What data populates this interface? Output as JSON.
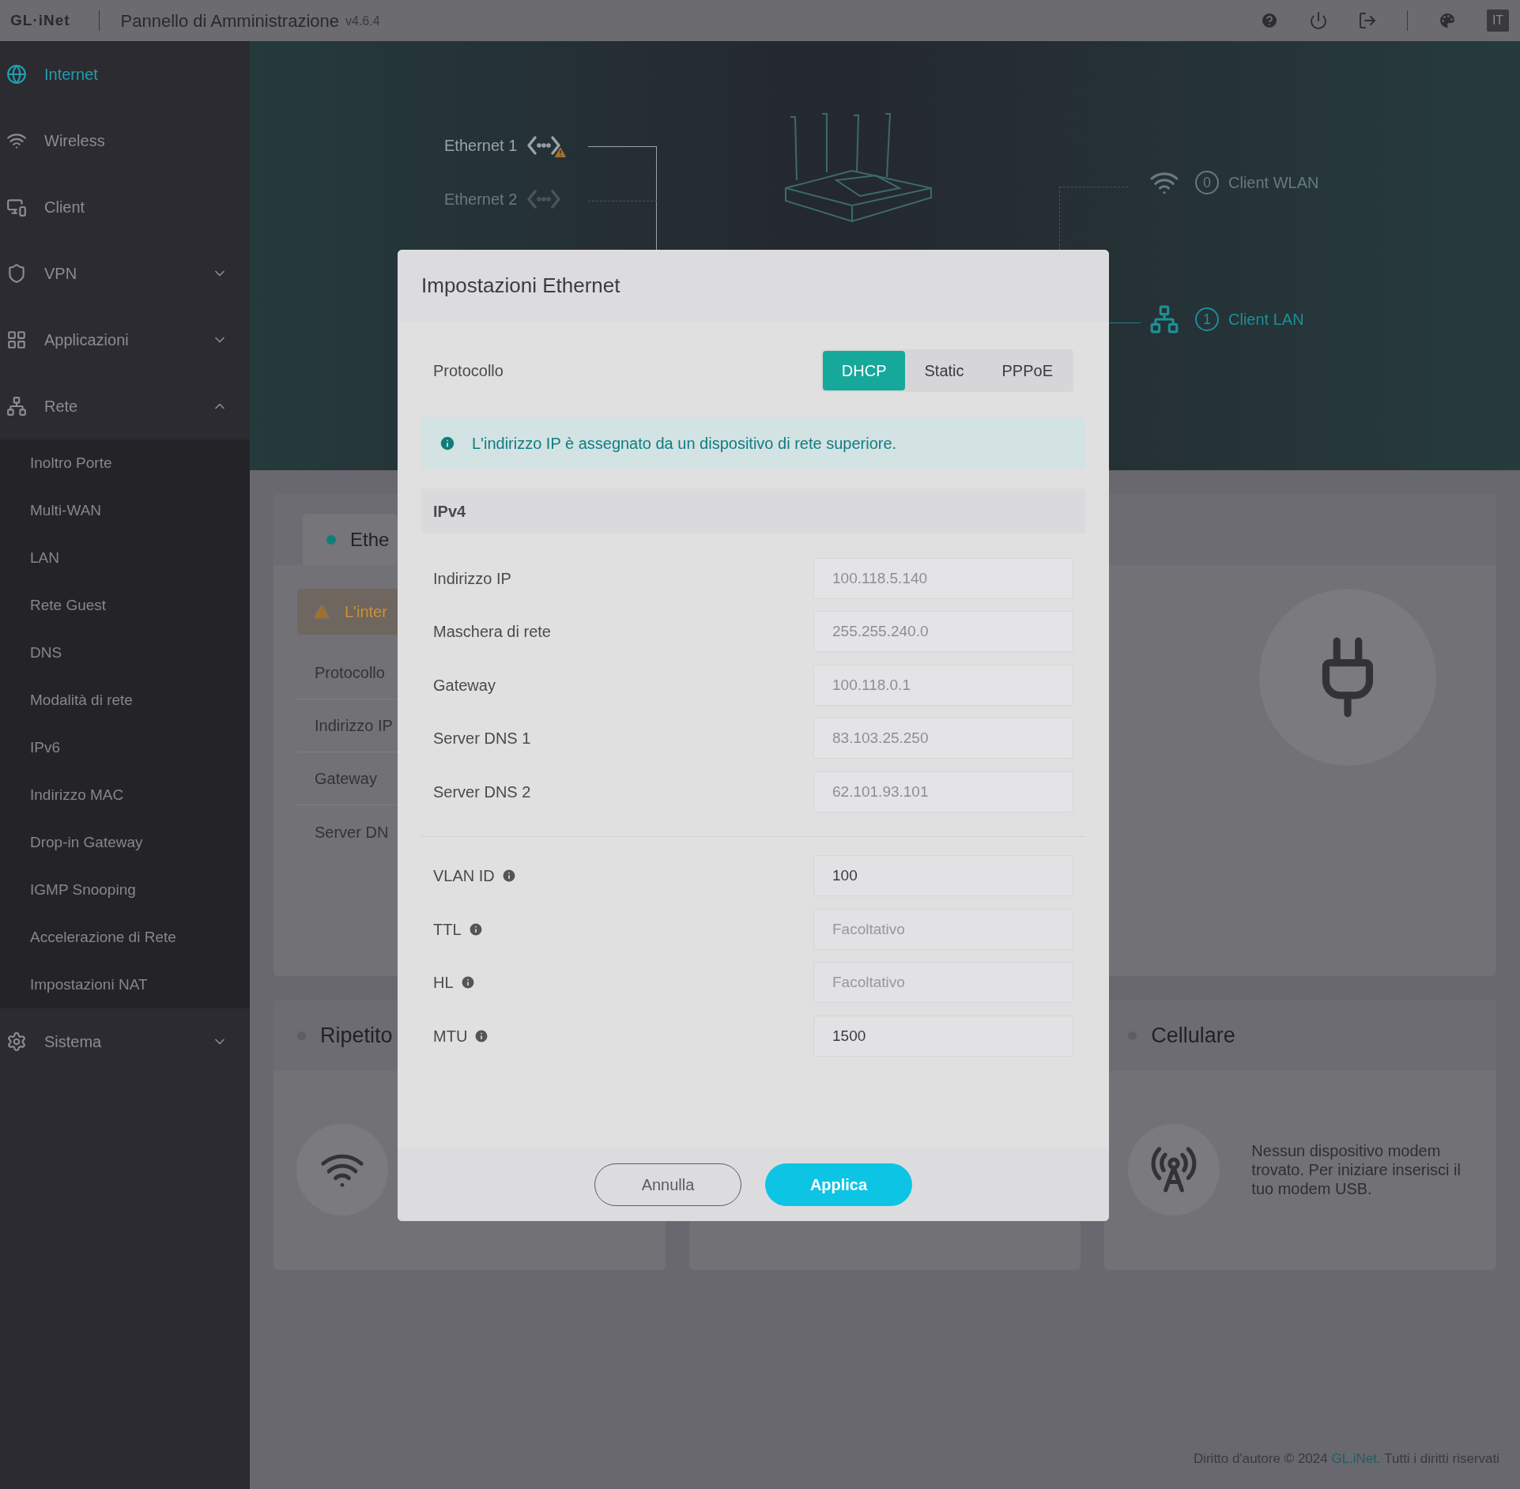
{
  "header": {
    "logo": "GL·iNet",
    "title": "Pannello di Amministrazione",
    "version": "v4.6.4",
    "language": "IT"
  },
  "sidebar": {
    "items": [
      {
        "label": "Internet",
        "kind": "link",
        "selected": true
      },
      {
        "label": "Wireless",
        "kind": "link",
        "selected": false
      },
      {
        "label": "Client",
        "kind": "link",
        "selected": false
      },
      {
        "label": "VPN",
        "kind": "group",
        "selected": false,
        "expanded": false
      },
      {
        "label": "Applicazioni",
        "kind": "group",
        "selected": false,
        "expanded": false
      },
      {
        "label": "Rete",
        "kind": "group",
        "selected": false,
        "expanded": true,
        "children": [
          {
            "label": "Inoltro Porte"
          },
          {
            "label": "Multi-WAN"
          },
          {
            "label": "LAN"
          },
          {
            "label": "Rete Guest"
          },
          {
            "label": "DNS"
          },
          {
            "label": "Modalità di rete"
          },
          {
            "label": "IPv6"
          },
          {
            "label": "Indirizzo MAC"
          },
          {
            "label": "Drop-in Gateway"
          },
          {
            "label": "IGMP Snooping"
          },
          {
            "label": "Accelerazione di Rete"
          },
          {
            "label": "Impostazioni NAT"
          }
        ]
      },
      {
        "label": "Sistema",
        "kind": "group",
        "selected": false,
        "expanded": false
      }
    ]
  },
  "diagram": {
    "ports": [
      {
        "label": "Ethernet 1",
        "connected": true,
        "warning": true
      },
      {
        "label": "Ethernet 2",
        "connected": false,
        "warning": false
      }
    ],
    "clients": [
      {
        "label": "Client WLAN",
        "count": "0",
        "active": false
      },
      {
        "label": "Client LAN",
        "count": "1",
        "active": true
      }
    ]
  },
  "ethernet_card": {
    "title": "Ethe",
    "warning": "L'inter",
    "rows": [
      "Protocollo",
      "Indirizzo IP",
      "Gateway",
      "Server DN"
    ]
  },
  "repeater_card": {
    "title": "Ripetito"
  },
  "cellular_card": {
    "title": "Cellulare",
    "message": "Nessun dispositivo modem trovato. Per iniziare inserisci il tuo modem USB."
  },
  "footer": {
    "before": "Diritto d'autore © 2024",
    "link": "GL.iNet.",
    "after": "Tutti i diritti riservati"
  },
  "dialog": {
    "title": "Impostazioni Ethernet",
    "protocol_label": "Protocollo",
    "protocols": [
      {
        "label": "DHCP",
        "selected": true
      },
      {
        "label": "Static",
        "selected": false
      },
      {
        "label": "PPPoE",
        "selected": false
      }
    ],
    "info": "L'indirizzo IP è assegnato da un dispositivo di rete superiore.",
    "section": "IPv4",
    "fields": [
      {
        "label": "Indirizzo IP",
        "value": "100.118.5.140",
        "disabled": true
      },
      {
        "label": "Maschera di rete",
        "value": "255.255.240.0",
        "disabled": true
      },
      {
        "label": "Gateway",
        "value": "100.118.0.1",
        "disabled": true
      },
      {
        "label": "Server DNS 1",
        "value": "83.103.25.250",
        "disabled": true
      },
      {
        "label": "Server DNS 2",
        "value": "62.101.93.101",
        "disabled": true
      }
    ],
    "advanced": [
      {
        "label": "VLAN ID",
        "value": "100"
      },
      {
        "label": "TTL",
        "placeholder": "Facoltativo"
      },
      {
        "label": "HL",
        "placeholder": "Facoltativo"
      },
      {
        "label": "MTU",
        "value": "1500"
      }
    ],
    "buttons": [
      {
        "label": "Annulla",
        "kind": "secondary"
      },
      {
        "label": "Applica",
        "kind": "primary"
      }
    ]
  }
}
